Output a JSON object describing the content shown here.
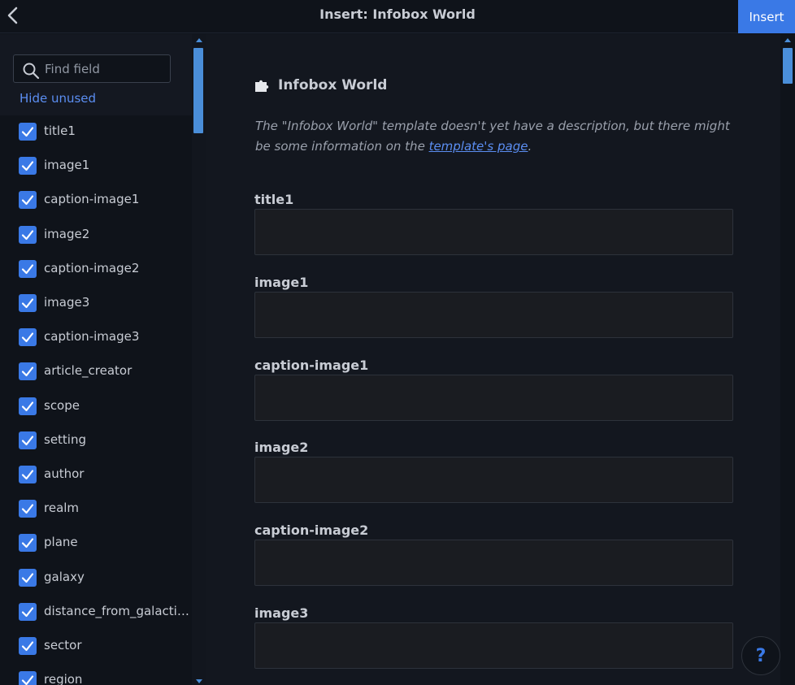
{
  "header": {
    "title": "Insert: Infobox World",
    "insert_label": "Insert"
  },
  "sidebar": {
    "search_placeholder": "Find field",
    "hide_unused": "Hide unused",
    "fields": [
      {
        "label": "title1",
        "checked": true
      },
      {
        "label": "image1",
        "checked": true
      },
      {
        "label": "caption-image1",
        "checked": true
      },
      {
        "label": "image2",
        "checked": true
      },
      {
        "label": "caption-image2",
        "checked": true
      },
      {
        "label": "image3",
        "checked": true
      },
      {
        "label": "caption-image3",
        "checked": true
      },
      {
        "label": "article_creator",
        "checked": true
      },
      {
        "label": "scope",
        "checked": true
      },
      {
        "label": "setting",
        "checked": true
      },
      {
        "label": "author",
        "checked": true
      },
      {
        "label": "realm",
        "checked": true
      },
      {
        "label": "plane",
        "checked": true
      },
      {
        "label": "galaxy",
        "checked": true
      },
      {
        "label": "distance_from_galacti…",
        "checked": true
      },
      {
        "label": "sector",
        "checked": true
      },
      {
        "label": "region",
        "checked": true
      }
    ]
  },
  "main": {
    "template_title": "Infobox World",
    "description_prefix": "The \"Infobox World\" template doesn't yet have a description, but there might be some information on the ",
    "description_link": "template's page",
    "description_suffix": ".",
    "params": [
      {
        "label": "title1",
        "value": ""
      },
      {
        "label": "image1",
        "value": ""
      },
      {
        "label": "caption-image1",
        "value": ""
      },
      {
        "label": "image2",
        "value": ""
      },
      {
        "label": "caption-image2",
        "value": ""
      },
      {
        "label": "image3",
        "value": ""
      }
    ]
  },
  "help": {
    "label": "?"
  },
  "icons": {
    "back": "chevron-left-icon",
    "search": "search-icon",
    "puzzle": "puzzle-icon",
    "check": "check-icon"
  },
  "colors": {
    "accent": "#3a79e6",
    "link": "#5b8ef2",
    "background": "#0f131a"
  }
}
